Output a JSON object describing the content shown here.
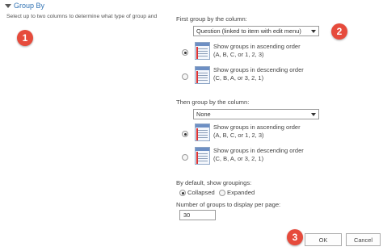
{
  "section": {
    "title": "Group By",
    "description": "Select up to two columns to determine what type of group and"
  },
  "callouts": [
    "1",
    "2",
    "3"
  ],
  "first_group": {
    "label": "First group by the column:",
    "selected": "Question (linked to item with edit menu)",
    "options": [
      {
        "line1": "Show groups in ascending order",
        "line2": "(A, B, C, or 1, 2, 3)",
        "checked": true
      },
      {
        "line1": "Show groups in descending order",
        "line2": "(C, B, A, or 3, 2, 1)",
        "checked": false
      }
    ]
  },
  "then_group": {
    "label": "Then group by the column:",
    "selected": "None",
    "options": [
      {
        "line1": "Show groups in ascending order",
        "line2": "(A, B, C, or 1, 2, 3)",
        "checked": true
      },
      {
        "line1": "Show groups in descending order",
        "line2": "(C, B, A, or 3, 2, 1)",
        "checked": false
      }
    ]
  },
  "default_show": {
    "label": "By default, show groupings:",
    "collapsed": "Collapsed",
    "expanded": "Expanded",
    "selected": "Collapsed"
  },
  "groups_per_page": {
    "label": "Number of groups to display per page:",
    "value": "30"
  },
  "buttons": {
    "ok": "OK",
    "cancel": "Cancel"
  },
  "colors": {
    "accent": "#3072b3",
    "callout": "#e64b3c"
  }
}
